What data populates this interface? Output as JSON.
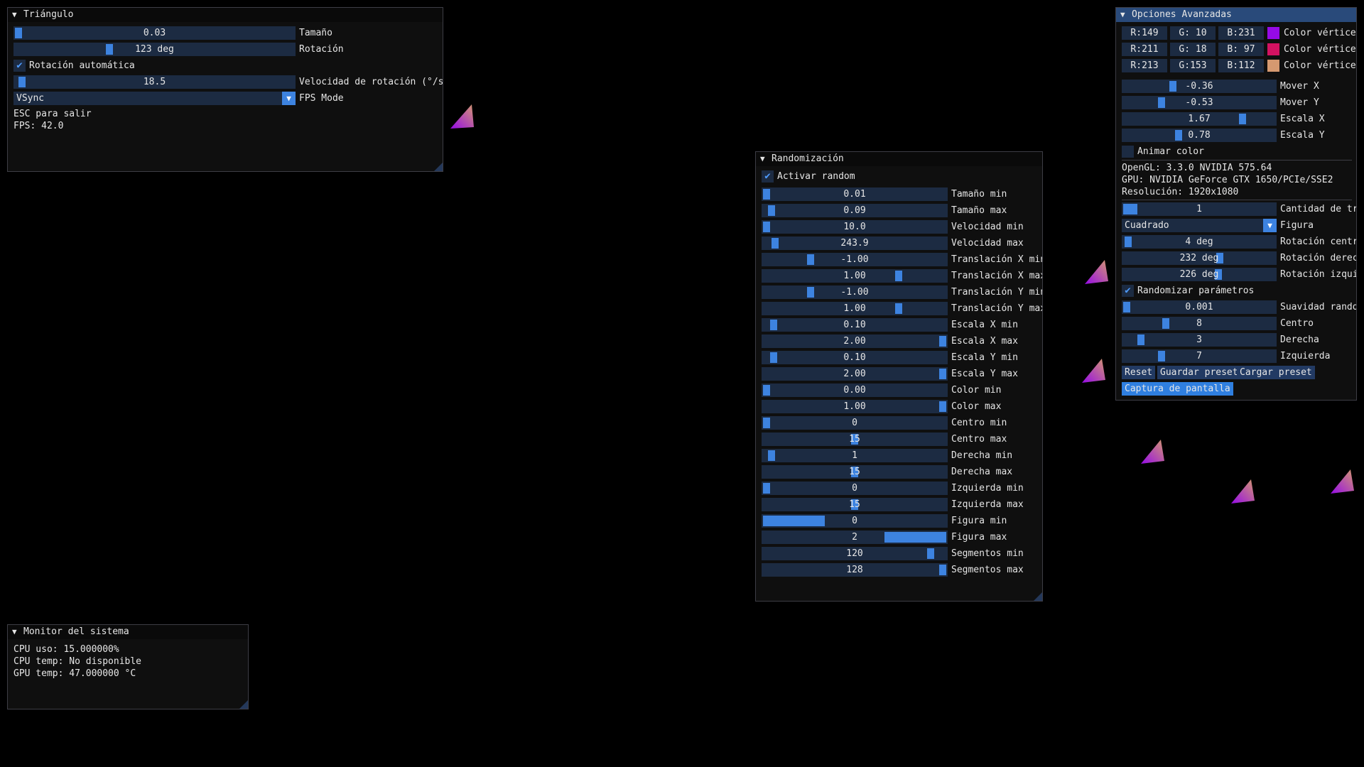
{
  "triangulo": {
    "title": "Triángulo",
    "tamano": {
      "value": "0.03",
      "label": "Tamaño"
    },
    "rotacion": {
      "value": "123 deg",
      "label": "Rotación"
    },
    "rotacion_auto": {
      "label": "Rotación automática",
      "checked": true
    },
    "velocidad": {
      "value": "18.5",
      "label": "Velocidad de rotación (°/s)"
    },
    "fps_mode": {
      "value": "VSync",
      "label": "FPS Mode"
    },
    "esc_text": "ESC para salir",
    "fps_text": "FPS: 42.0"
  },
  "monitor": {
    "title": "Monitor del sistema",
    "cpu_uso": "CPU uso: 15.000000%",
    "cpu_temp": "CPU temp: No disponible",
    "gpu_temp": "GPU temp: 47.000000 °C"
  },
  "random": {
    "title": "Randomización",
    "activar": {
      "label": "Activar random",
      "checked": true
    },
    "sliders": [
      {
        "value": "0.01",
        "label": "Tamaño min",
        "fraction": 0.0
      },
      {
        "value": "0.09",
        "label": "Tamaño max",
        "fraction": 0.03
      },
      {
        "value": "10.0",
        "label": "Velocidad min",
        "fraction": 0.0
      },
      {
        "value": "243.9",
        "label": "Velocidad max",
        "fraction": 0.05
      },
      {
        "value": "-1.00",
        "label": "Translación X min",
        "fraction": 0.25
      },
      {
        "value": "1.00",
        "label": "Translación X max",
        "fraction": 0.75
      },
      {
        "value": "-1.00",
        "label": "Translación Y min",
        "fraction": 0.25
      },
      {
        "value": "1.00",
        "label": "Translación Y max",
        "fraction": 0.75
      },
      {
        "value": "0.10",
        "label": "Escala X min",
        "fraction": 0.04
      },
      {
        "value": "2.00",
        "label": "Escala X max",
        "fraction": 1.0
      },
      {
        "value": "0.10",
        "label": "Escala Y min",
        "fraction": 0.04
      },
      {
        "value": "2.00",
        "label": "Escala Y max",
        "fraction": 1.0
      },
      {
        "value": "0.00",
        "label": "Color min",
        "fraction": 0.0
      },
      {
        "value": "1.00",
        "label": "Color max",
        "fraction": 1.0
      },
      {
        "value": "0",
        "label": "Centro min",
        "fraction": 0.0
      },
      {
        "value": "15",
        "label": "Centro max",
        "fraction": 0.5
      },
      {
        "value": "1",
        "label": "Derecha min",
        "fraction": 0.03
      },
      {
        "value": "15",
        "label": "Derecha max",
        "fraction": 0.5
      },
      {
        "value": "0",
        "label": "Izquierda min",
        "fraction": 0.0
      },
      {
        "value": "15",
        "label": "Izquierda max",
        "fraction": 0.5
      },
      {
        "value": "0",
        "label": "Figura min",
        "fraction": 0.0,
        "wide": "left"
      },
      {
        "value": "2",
        "label": "Figura max",
        "fraction": 1.0,
        "wide": "right"
      },
      {
        "value": "120",
        "label": "Segmentos min",
        "fraction": 0.93
      },
      {
        "value": "128",
        "label": "Segmentos max",
        "fraction": 1.0
      }
    ]
  },
  "avanzadas": {
    "title": "Opciones Avanzadas",
    "colors": [
      {
        "r": "R:149",
        "g": "G: 10",
        "b": "B:231",
        "swatch": "#950ae7",
        "label": "Color vértice su"
      },
      {
        "r": "R:211",
        "g": "G: 18",
        "b": "B: 97",
        "swatch": "#d31261",
        "label": "Color vértice iz"
      },
      {
        "r": "R:213",
        "g": "G:153",
        "b": "B:112",
        "swatch": "#d59970",
        "label": "Color vértice de"
      }
    ],
    "sliders1": [
      {
        "value": "-0.36",
        "label": "Mover X",
        "fraction": 0.32
      },
      {
        "value": "-0.53",
        "label": "Mover Y",
        "fraction": 0.24
      },
      {
        "value": "1.67",
        "label": "Escala X",
        "fraction": 0.8
      },
      {
        "value": "0.78",
        "label": "Escala Y",
        "fraction": 0.36
      }
    ],
    "animar": {
      "label": "Animar color",
      "checked": false
    },
    "opengl": "OpenGL: 3.3.0 NVIDIA 575.64",
    "gpu": "GPU: NVIDIA GeForce GTX 1650/PCIe/SSE2",
    "resolucion": "Resolución: 1920x1080",
    "cantidad": {
      "value": "1",
      "label": "Cantidad de tri",
      "fraction": 0.0
    },
    "figura": {
      "value": "Cuadrado",
      "label": "Figura"
    },
    "sliders2": [
      {
        "value": "4 deg",
        "label": "Rotación centro",
        "fraction": 0.01
      },
      {
        "value": "232 deg",
        "label": "Rotación derecha",
        "fraction": 0.64
      },
      {
        "value": "226 deg",
        "label": "Rotación izquier",
        "fraction": 0.63
      }
    ],
    "randomizar": {
      "label": "Randomizar parámetros",
      "checked": true
    },
    "sliders3": [
      {
        "value": "0.001",
        "label": "Suavidad random",
        "fraction": 0.0
      },
      {
        "value": "8",
        "label": "Centro",
        "fraction": 0.27
      },
      {
        "value": "3",
        "label": "Derecha",
        "fraction": 0.1
      },
      {
        "value": "7",
        "label": "Izquierda",
        "fraction": 0.24
      }
    ],
    "buttons": {
      "reset": "Reset",
      "guardar": "Guardar preset",
      "cargar": "Cargar preset",
      "captura": "Captura de pantalla"
    }
  },
  "colors": {
    "accent": "#3d83e0",
    "frame": "#1c2b42",
    "title_active": "#294a7a",
    "background": "#000000"
  }
}
